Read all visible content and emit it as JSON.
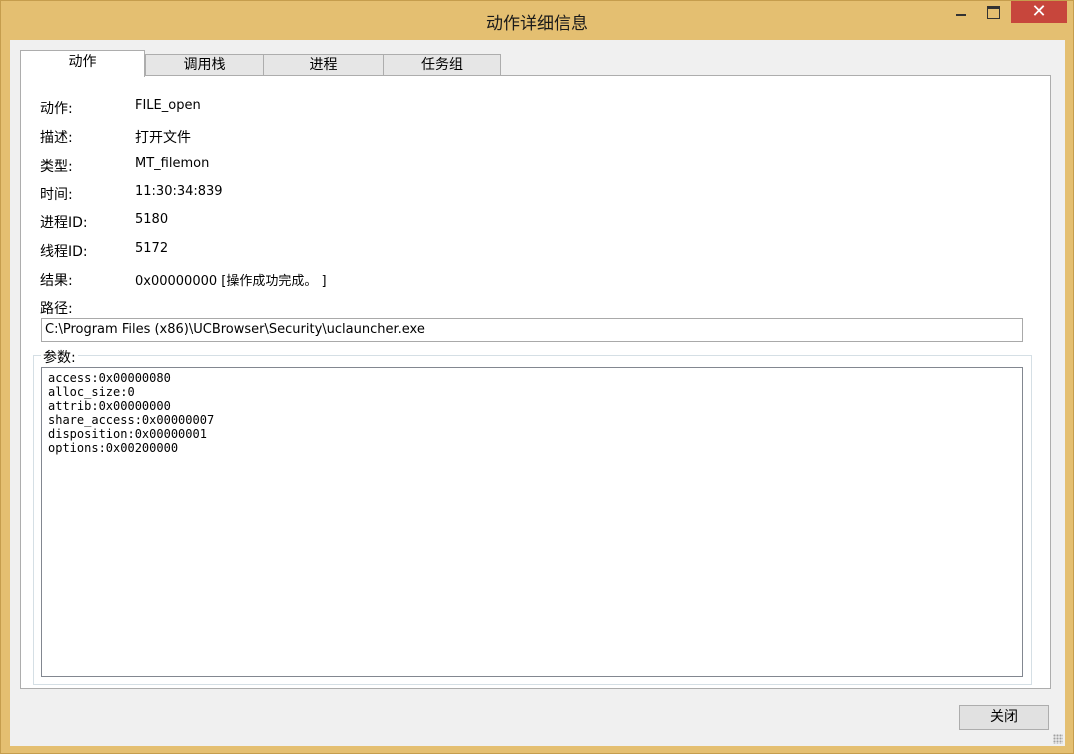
{
  "window": {
    "title": "动作详细信息",
    "close_glyph": "✕"
  },
  "tabs": [
    {
      "label": "动作",
      "active": true
    },
    {
      "label": "调用栈",
      "active": false
    },
    {
      "label": "进程",
      "active": false
    },
    {
      "label": "任务组",
      "active": false
    }
  ],
  "details": {
    "action_label": "动作:",
    "action_value": "FILE_open",
    "desc_label": "描述:",
    "desc_value": "打开文件",
    "type_label": "类型:",
    "type_value": "MT_filemon",
    "time_label": "时间:",
    "time_value": "11:30:34:839",
    "pid_label": "进程ID:",
    "pid_value": "5180",
    "tid_label": "线程ID:",
    "tid_value": "5172",
    "result_label": "结果:",
    "result_value": "0x00000000 [操作成功完成。 ]"
  },
  "path": {
    "label": "路径:",
    "value": "C:\\Program Files (x86)\\UCBrowser\\Security\\uclauncher.exe"
  },
  "params": {
    "label": "参数:",
    "lines": [
      "access:0x00000080",
      "alloc_size:0",
      "attrib:0x00000000",
      "share_access:0x00000007",
      "disposition:0x00000001",
      "options:0x00200000"
    ]
  },
  "buttons": {
    "close_label": "关闭"
  },
  "colors": {
    "frame": "#e4bf71",
    "close_button": "#c7463c"
  }
}
